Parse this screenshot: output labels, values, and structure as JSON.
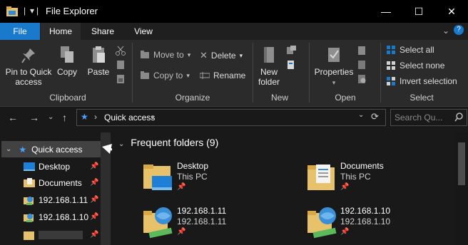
{
  "window": {
    "title": "File Explorer",
    "qat_pipe": "|",
    "qat_dropdown": "▾",
    "minimize": "—",
    "maximize": "☐",
    "close": "✕"
  },
  "tabs": [
    "File",
    "Home",
    "Share",
    "View"
  ],
  "ribbon": {
    "help": "?",
    "collapse": "⌄",
    "clipboard": {
      "pin_label_1": "Pin to Quick",
      "pin_label_2": "access",
      "copy": "Copy",
      "paste": "Paste",
      "group": "Clipboard"
    },
    "organize": {
      "move_to": "Move to",
      "copy_to": "Copy to",
      "delete": "Delete",
      "rename": "Rename",
      "group": "Organize"
    },
    "new": {
      "new_folder_1": "New",
      "new_folder_2": "folder",
      "group": "New"
    },
    "open": {
      "properties": "Properties",
      "group": "Open"
    },
    "select": {
      "select_all": "Select all",
      "select_none": "Select none",
      "invert": "Invert selection",
      "group": "Select"
    }
  },
  "address": {
    "path": "Quick access",
    "separator": "›",
    "search_placeholder": "Search Qu..."
  },
  "navpane": {
    "items": [
      {
        "label": "Quick access"
      },
      {
        "label": "Desktop"
      },
      {
        "label": "Documents"
      },
      {
        "label": "192.168.1.11"
      },
      {
        "label": "192.168.1.10"
      },
      {
        "label": ""
      }
    ]
  },
  "content": {
    "section_title": "Frequent folders (9)",
    "folders": [
      {
        "name": "Desktop",
        "sub": "This PC"
      },
      {
        "name": "Documents",
        "sub": "This PC"
      },
      {
        "name": "192.168.1.11",
        "sub": "192.168.1.11"
      },
      {
        "name": "192.168.1.10",
        "sub": "192.168.1.10"
      }
    ]
  },
  "colors": {
    "accent": "#1979ca",
    "selection": "#424242",
    "folder": "#e8c26a"
  }
}
